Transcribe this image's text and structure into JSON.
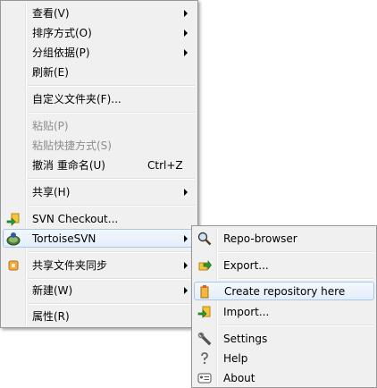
{
  "main_menu": {
    "items": [
      {
        "label": "查看(V)"
      },
      {
        "label": "排序方式(O)"
      },
      {
        "label": "分组依据(P)"
      },
      {
        "label": "刷新(E)"
      },
      {
        "label": "自定义文件夹(F)..."
      },
      {
        "label": "粘贴(P)"
      },
      {
        "label": "粘贴快捷方式(S)"
      },
      {
        "label": "撤消 重命名(U)",
        "shortcut": "Ctrl+Z"
      },
      {
        "label": "共享(H)"
      },
      {
        "label": "SVN Checkout...",
        "icon": "svn-checkout-icon"
      },
      {
        "label": "TortoiseSVN",
        "icon": "tortoisesvn-icon"
      },
      {
        "label": "共享文件夹同步",
        "icon": "folder-sync-icon"
      },
      {
        "label": "新建(W)"
      },
      {
        "label": "属性(R)"
      }
    ]
  },
  "sub_menu": {
    "items": [
      {
        "label": "Repo-browser",
        "icon": "repo-browser-icon"
      },
      {
        "label": "Export...",
        "icon": "export-icon"
      },
      {
        "label": "Create repository here",
        "icon": "create-repository-icon"
      },
      {
        "label": "Import...",
        "icon": "import-icon"
      },
      {
        "label": "Settings",
        "icon": "settings-icon"
      },
      {
        "label": "Help",
        "icon": "help-icon"
      },
      {
        "label": "About",
        "icon": "about-icon"
      }
    ]
  },
  "colors": {
    "menu_background": "#f0f0f0",
    "menu_border": "#979797",
    "highlight_border": "#a8c8eb",
    "disabled_text": "#8d8d8d"
  }
}
